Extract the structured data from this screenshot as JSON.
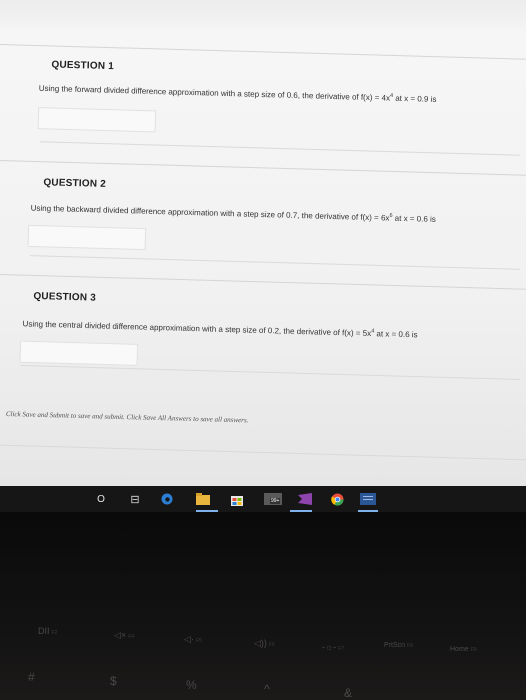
{
  "questions": [
    {
      "title": "QUESTION 1",
      "text_prefix": "Using the forward divided difference approximation with a step size of 0.6, the derivative of ",
      "func_base": "f(x) = 4x",
      "exponent": "4",
      "text_suffix": " at x = 0.9 is"
    },
    {
      "title": "QUESTION 2",
      "text_prefix": "Using the backward divided difference approximation with a step size of 0.7, the derivative of ",
      "func_base": "f(x) = 6x",
      "exponent": "6",
      "text_suffix": " at x = 0.6 is"
    },
    {
      "title": "QUESTION 3",
      "text_prefix": "Using the central divided difference approximation with a step size of 0.2, the derivative of ",
      "func_base": "f(x) = 5x",
      "exponent": "4",
      "text_suffix": " at x = 0.6 is"
    }
  ],
  "footer": {
    "note": "Click Save and Submit to save and submit. Click Save All Answers to save all answers."
  },
  "taskbar": {
    "search_glyph": "O",
    "taskview_glyph": "⊟",
    "badge": "99+"
  },
  "keyboard": {
    "f2_top": "DII",
    "f2": "F2",
    "f4_top": "◁×",
    "f4": "F4",
    "f5_top": "◁·",
    "f5": "F5",
    "f6_top": "◁))",
    "f6": "F6",
    "f7_top": "-☼-",
    "f7": "F7",
    "f8_top": "PrtScn",
    "f8": "F8",
    "f9_top": "Home",
    "f9": "F9",
    "hash": "#",
    "dollar": "$",
    "percent": "%",
    "caret": "^",
    "amp": "&"
  },
  "colors": {
    "screen_bg": "#f4f4f4",
    "taskbar_bg": "#161617",
    "accent_blue": "#2a7fd4"
  }
}
